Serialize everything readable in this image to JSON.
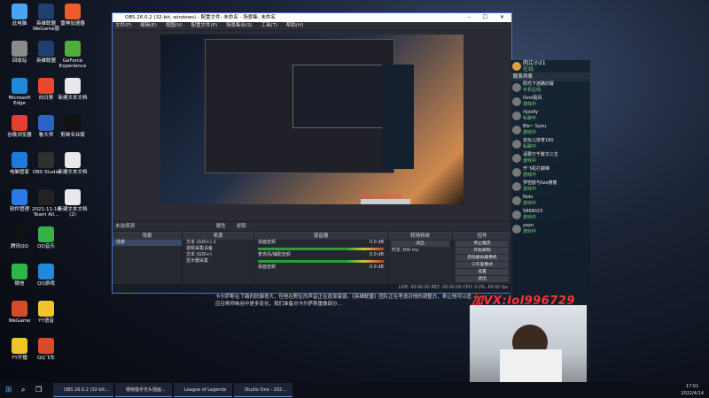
{
  "desktop_icons": [
    {
      "label": "此电脑",
      "color": "#4aa3f0"
    },
    {
      "label": "英雄联盟WeGame版",
      "color": "#1f3f6f"
    },
    {
      "label": "雷神加速器",
      "color": "#f05b2a"
    },
    {
      "label": "回收站",
      "color": "#8a8a8a"
    },
    {
      "label": "英雄联盟",
      "color": "#1f3f6f"
    },
    {
      "label": "GeForce Experience",
      "color": "#4fae3a"
    },
    {
      "label": "Microsoft Edge",
      "color": "#1f8ad8"
    },
    {
      "label": "向日葵",
      "color": "#e94b2a"
    },
    {
      "label": "新建文本文档",
      "color": "#e8e8e8"
    },
    {
      "label": "谷歌浏览器",
      "color": "#e43f2e"
    },
    {
      "label": "鲁大师",
      "color": "#2b65c4"
    },
    {
      "label": "剪映专业版",
      "color": "#111111"
    },
    {
      "label": "电脑管家",
      "color": "#1d7be0"
    },
    {
      "label": "OBS Studio",
      "color": "#303030"
    },
    {
      "label": "新建文本文档",
      "color": "#e8e8e8"
    },
    {
      "label": "软件管理",
      "color": "#2c7be5"
    },
    {
      "label": "2021-11-18 Team All...",
      "color": "#222222"
    },
    {
      "label": "新建文本文档(2)",
      "color": "#e8e8e8"
    },
    {
      "label": "腾讯QQ",
      "color": "#111111"
    },
    {
      "label": "QQ音乐",
      "color": "#35b24a"
    },
    {
      "label": "微信",
      "color": "#2fb64a"
    },
    {
      "label": "QQ游戏",
      "color": "#1f8ad8"
    },
    {
      "label": "WeGame",
      "color": "#d94a2a"
    },
    {
      "label": "YY语音",
      "color": "#f0c52a"
    },
    {
      "label": "YY开播",
      "color": "#f0c52a"
    },
    {
      "label": "QQ飞车",
      "color": "#d94a2a"
    }
  ],
  "obs": {
    "title": "OBS 26.0.2 (32-bit, windows) - 配置文件: 未命名 - 场景集: 未命名",
    "menu": [
      "文件(F)",
      "编辑(E)",
      "视图(V)",
      "配置文件(P)",
      "场景集合(S)",
      "工具(T)",
      "帮助(H)"
    ],
    "rank_label": "未选择源",
    "tabs": [
      "属性",
      "滤镜"
    ],
    "scenes_title": "场景",
    "scenes": [
      "场景"
    ],
    "sources_title": "来源",
    "sources": [
      "文本 (GDI+) 2",
      "视频采集设备",
      "文本 (GDI+)",
      "显示器采集"
    ],
    "mixer_title": "混音器",
    "mixer": [
      {
        "name": "桌面音频",
        "db": "0.0 dB"
      },
      {
        "name": "麦克风/辅助音频",
        "db": "0.0 dB"
      },
      {
        "name": "桌面音频",
        "db": "0.0 dB"
      }
    ],
    "transitions_title": "转场特效",
    "transition": "淡出",
    "duration_label": "时长",
    "duration": "300 ms",
    "controls_title": "控件",
    "controls": [
      "停止推流",
      "开始录制",
      "启动虚拟摄像机",
      "工作室模式",
      "设置",
      "退出"
    ],
    "status": "LIVE: 00:00:00    REC: 00:00:00    CPU: 0.0%, 60.00 fps"
  },
  "chat": {
    "title": "肉江小21",
    "status": "在线",
    "header": "联系列表",
    "items": [
      {
        "name": "阳光下迷路旧幂",
        "status": "手机在线"
      },
      {
        "name": "Ovoi极风",
        "status": "游戏中"
      },
      {
        "name": "rtjoolly",
        "status": "私聊中"
      },
      {
        "name": "Ble~ Syou",
        "status": "游戏中"
      },
      {
        "name": "去玩儿体育180",
        "status": "私聊中"
      },
      {
        "name": "请要万千繁华三生",
        "status": "游戏中"
      },
      {
        "name": "开飞机打巅峰",
        "status": "游戏中"
      },
      {
        "name": "罗密欧与lize黛丽",
        "status": "游戏中"
      },
      {
        "name": "Nolo",
        "status": "游戏中"
      },
      {
        "name": "5868023",
        "status": "游戏中"
      },
      {
        "name": "yoyo",
        "status": "游戏中"
      }
    ]
  },
  "watermark": "加VX:lol996729",
  "caption": "卡尔萨斯在下路的防御塔大，但他在野区的声音正在逐渐衰弱。《英雄联盟》团队正在考虑对他的调整方，来让他可以适应召唤师峡谷中更多变化，我们准备对卡尔萨斯重做部分...",
  "taskbar": {
    "apps": [
      "OBS 26.0.2 (32-bit...",
      "楼雨猎手无头插画...",
      "League of Legends",
      "Studio One - 202..."
    ],
    "time": "17:01",
    "date": "2022/4/14"
  }
}
